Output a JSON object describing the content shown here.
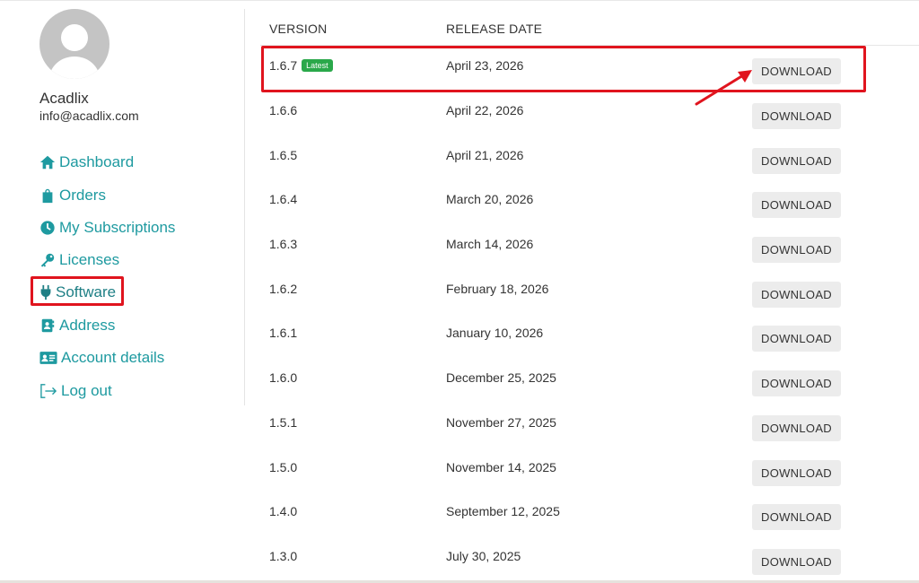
{
  "user": {
    "name": "Acadlix",
    "email": "info@acadlix.com"
  },
  "nav": {
    "items": [
      {
        "label": "Dashboard",
        "icon": "home-icon"
      },
      {
        "label": "Orders",
        "icon": "shopping-bag-icon"
      },
      {
        "label": "My Subscriptions",
        "icon": "clock-icon"
      },
      {
        "label": "Licenses",
        "icon": "key-icon"
      },
      {
        "label": "Software",
        "icon": "plug-icon",
        "active": true
      },
      {
        "label": "Address",
        "icon": "address-book-icon"
      },
      {
        "label": "Account details",
        "icon": "id-card-icon"
      },
      {
        "label": "Log out",
        "icon": "logout-icon"
      }
    ]
  },
  "table": {
    "headers": {
      "version": "VERSION",
      "release_date": "RELEASE DATE"
    },
    "download_label": "DOWNLOAD",
    "latest_badge": "Latest",
    "rows": [
      {
        "version": "1.6.7",
        "date": "April 23, 2026",
        "latest": true
      },
      {
        "version": "1.6.6",
        "date": "April 22, 2026"
      },
      {
        "version": "1.6.5",
        "date": "April 21, 2026"
      },
      {
        "version": "1.6.4",
        "date": "March 20, 2026"
      },
      {
        "version": "1.6.3",
        "date": "March 14, 2026"
      },
      {
        "version": "1.6.2",
        "date": "February 18, 2026"
      },
      {
        "version": "1.6.1",
        "date": "January 10, 2026"
      },
      {
        "version": "1.6.0",
        "date": "December 25, 2025"
      },
      {
        "version": "1.5.1",
        "date": "November 27, 2025"
      },
      {
        "version": "1.5.0",
        "date": "November 14, 2025"
      },
      {
        "version": "1.4.0",
        "date": "September 12, 2025"
      },
      {
        "version": "1.3.0",
        "date": "July 30, 2025"
      }
    ]
  },
  "colors": {
    "accent": "#1e9aa0",
    "highlight": "#e0141e",
    "badge": "#2aa84a"
  }
}
